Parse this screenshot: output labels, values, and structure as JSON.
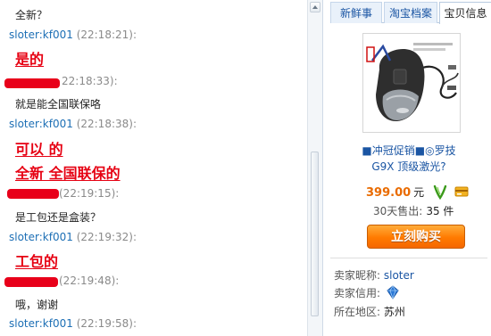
{
  "chat": {
    "msg_1": "全新？",
    "hdr_1": {
      "sender": "sloter:kf001",
      "time": "(22:18:21):"
    },
    "big_1": "是的",
    "hdr_2_time": "22:18:33):",
    "msg_2": "就是能全国联保咯",
    "hdr_3": {
      "sender": "sloter:kf001",
      "time": "(22:18:38):"
    },
    "big_2": "可以 的",
    "big_3": "全新 全国联保的",
    "hdr_4_time": "(22:19:15):",
    "msg_3": "是工包还是盒装？",
    "hdr_5": {
      "sender": "sloter:kf001",
      "time": "(22:19:32):"
    },
    "big_4": "工包的",
    "hdr_6_time": "(22:19:48):",
    "msg_4": "哦，谢谢",
    "hdr_7": {
      "sender": "sloter:kf001",
      "time": "(22:19:58):"
    }
  },
  "tabs": [
    {
      "label": "新鲜事"
    },
    {
      "label": "淘宝档案"
    },
    {
      "label": "宝贝信息"
    }
  ],
  "product": {
    "title_line1": "■冲冠促销■◎罗技",
    "title_line2": "G9X 顶级激光?",
    "price": "399.00",
    "price_unit": "元",
    "sold_label": "30天售出:",
    "sold_value": "35 件",
    "buy_label": "立刻购买"
  },
  "seller": {
    "nick_label": "卖家昵称:",
    "nick_value": "sloter",
    "credit_label": "卖家信用:",
    "region_label": "所在地区:",
    "region_value": "苏州"
  },
  "colors": {
    "accent_red": "#e60012",
    "link_blue": "#1a55a3",
    "price_orange": "#e96b00",
    "buy_orange": "#ff7a00"
  }
}
